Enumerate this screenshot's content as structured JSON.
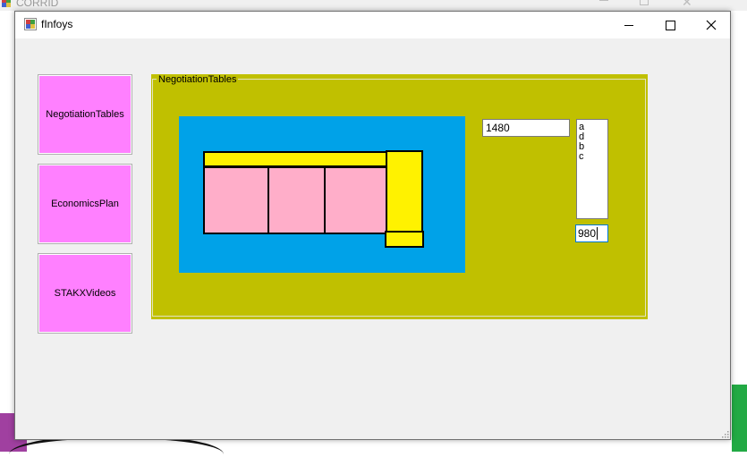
{
  "background_window": {
    "title": "CORRID"
  },
  "window": {
    "title": "fInfoys"
  },
  "side_buttons": [
    {
      "label": "NegotiationTables"
    },
    {
      "label": "EconomicsPlan"
    },
    {
      "label": "STAKXVideos"
    }
  ],
  "group": {
    "title": "NegotiationTables"
  },
  "inputs": {
    "field1_value": "1480",
    "field2_value": "980"
  },
  "listbox": {
    "items": [
      "a",
      "d",
      "b",
      "c"
    ]
  },
  "colors": {
    "button_pink": "#ff80ff",
    "panel_olive": "#c0c000",
    "canvas_blue": "#00a2e8",
    "shape_yellow": "#fff200",
    "shape_pink": "#ffaec9"
  }
}
